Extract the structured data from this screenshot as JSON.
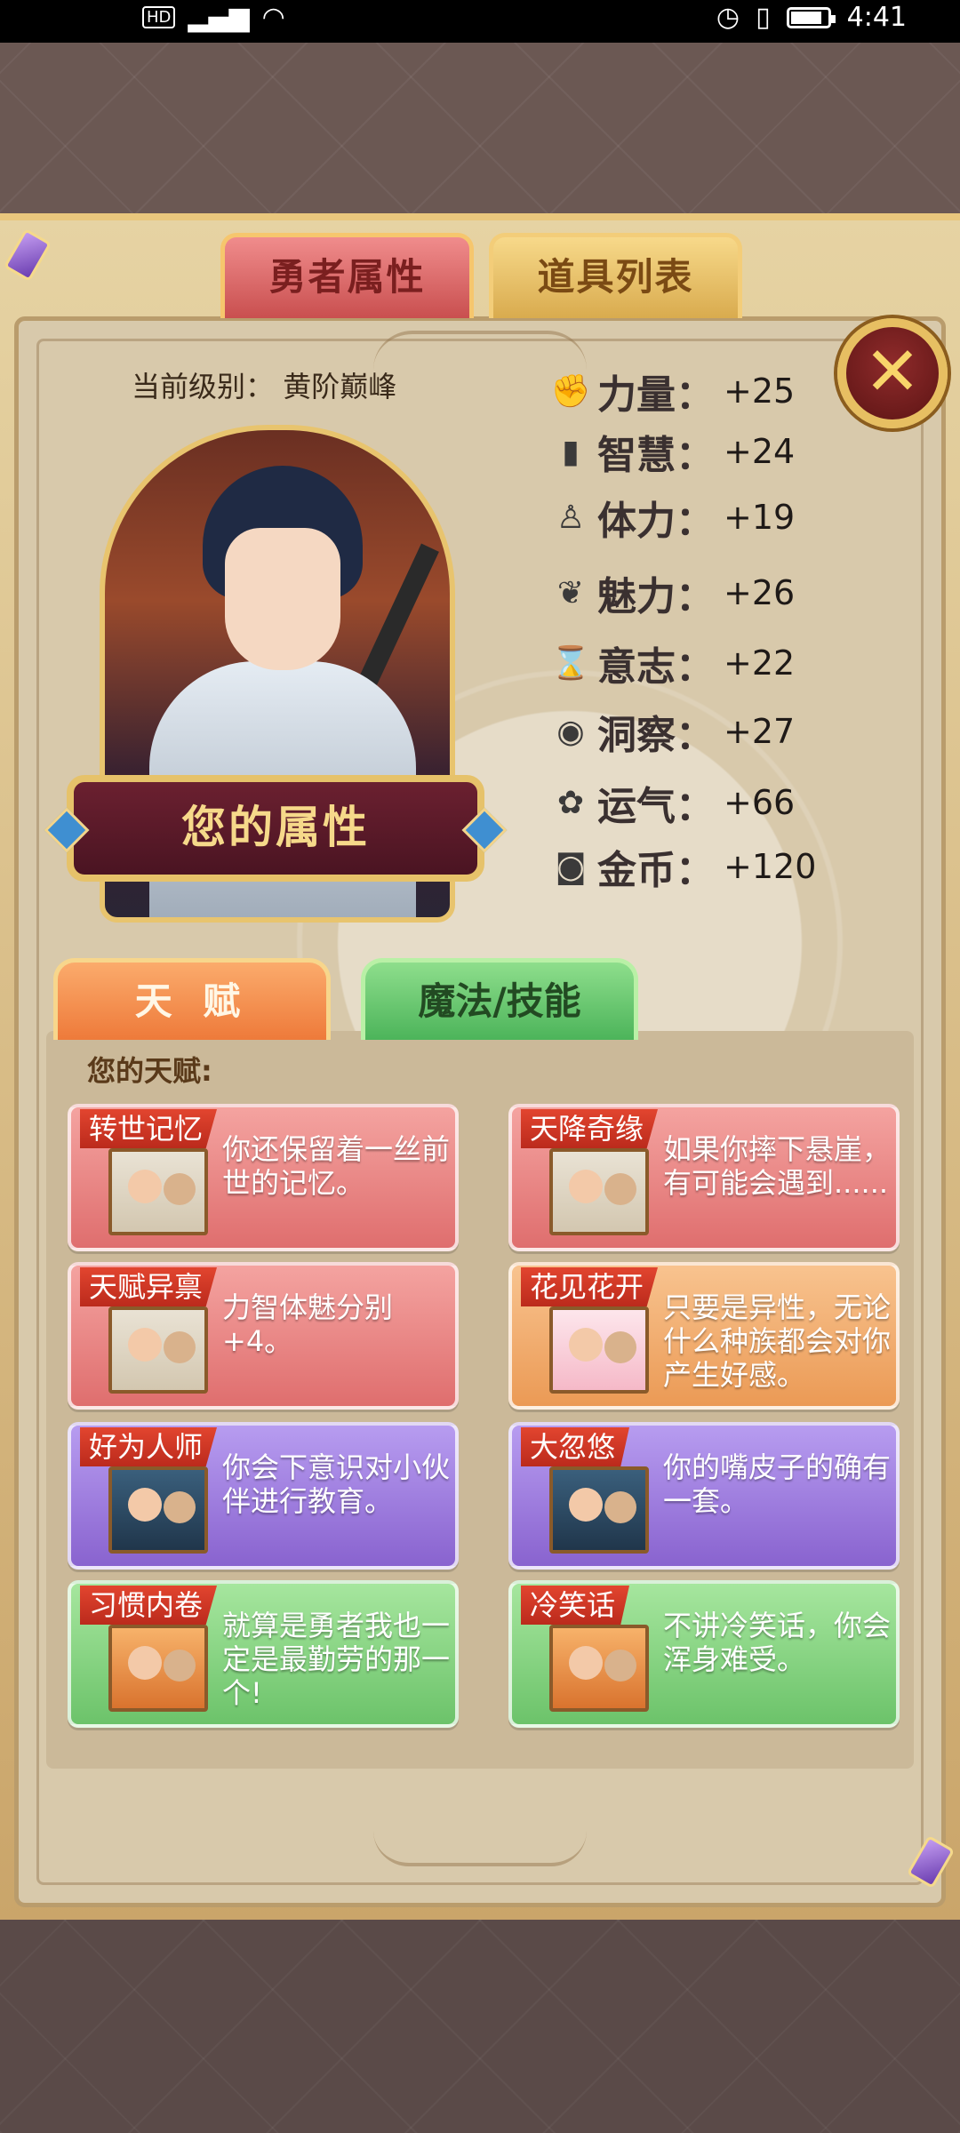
{
  "status_bar": {
    "hd": "HD",
    "time": "4:41",
    "battery_level": 0.85
  },
  "tabs": {
    "hero": "勇者属性",
    "items": "道具列表"
  },
  "close_label": "✕",
  "level": {
    "label": "当前级别：",
    "value": "黄阶巅峰"
  },
  "banner": "您的属性",
  "stats": [
    {
      "name": "力量",
      "icon": "strength-icon",
      "value": "+25"
    },
    {
      "name": "智慧",
      "icon": "book-icon",
      "value": "+24"
    },
    {
      "name": "体力",
      "icon": "stamina-icon",
      "value": "+19"
    },
    {
      "name": "魅力",
      "icon": "charm-icon",
      "value": "+26"
    },
    {
      "name": "意志",
      "icon": "hourglass-icon",
      "value": "+22"
    },
    {
      "name": "洞察",
      "icon": "eye-icon",
      "value": "+27"
    },
    {
      "name": "运气",
      "icon": "clover-icon",
      "value": "+66"
    },
    {
      "name": "金币",
      "icon": "coin-icon",
      "value": "+120"
    }
  ],
  "talent_tabs": {
    "talent": "天 赋",
    "magic": "魔法/技能"
  },
  "talent_heading": "您的天赋:",
  "talents": [
    {
      "title": "转世记忆",
      "desc": "你还保留着一丝前世的记忆。",
      "color": "red"
    },
    {
      "title": "天降奇缘",
      "desc": "如果你摔下悬崖，有可能会遇到......",
      "color": "red"
    },
    {
      "title": "天赋异禀",
      "desc": "力智体魅分别+4。",
      "color": "red"
    },
    {
      "title": "花见花开",
      "desc": "只要是异性，无论什么种族都会对你产生好感。",
      "color": "orange"
    },
    {
      "title": "好为人师",
      "desc": "你会下意识对小伙伴进行教育。",
      "color": "purple"
    },
    {
      "title": "大忽悠",
      "desc": "你的嘴皮子的确有一套。",
      "color": "purple"
    },
    {
      "title": "习惯内卷",
      "desc": "就算是勇者我也一定是最勤劳的那一个!",
      "color": "green"
    },
    {
      "title": "冷笑话",
      "desc": "不讲冷笑话，你会浑身难受。",
      "color": "green"
    }
  ]
}
